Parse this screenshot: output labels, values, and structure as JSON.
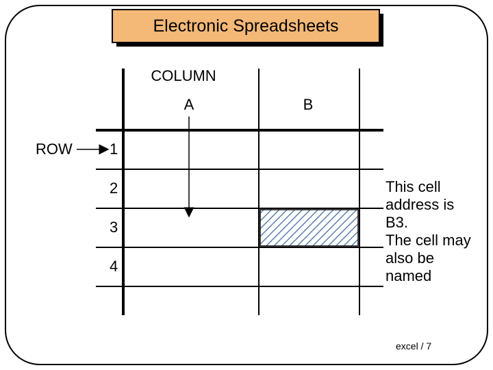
{
  "title": "Electronic Spreadsheets",
  "labels": {
    "column": "COLUMN",
    "row": "ROW",
    "colA": "A",
    "colB": "B",
    "r1": "1",
    "r2": "2",
    "r3": "3",
    "r4": "4"
  },
  "annotation_lines": {
    "l1": "This cell",
    "l2": "address is",
    "l3": "B3.",
    "l4": "The cell may",
    "l5": "also be",
    "l6": "named"
  },
  "footer": "excel / 7",
  "colors": {
    "titleFill": "#f4b877",
    "border": "#000000",
    "grid": "#000000",
    "hatch": "#5a7fb0"
  }
}
